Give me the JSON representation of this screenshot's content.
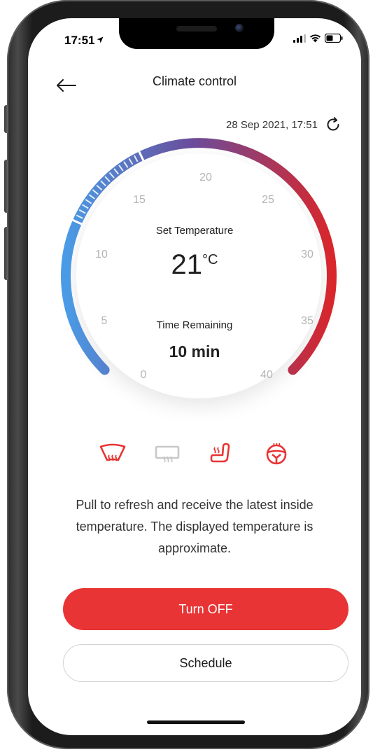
{
  "status_bar": {
    "time": "17:51"
  },
  "header": {
    "title": "Climate control"
  },
  "refresh": {
    "timestamp": "28 Sep 2021, 17:51"
  },
  "dial": {
    "tick_labels": [
      "0",
      "5",
      "10",
      "15",
      "20",
      "25",
      "30",
      "35",
      "40"
    ],
    "set_temperature_label": "Set Temperature",
    "temperature_value": "21",
    "temperature_unit": "°C",
    "time_remaining_label": "Time Remaining",
    "time_remaining_value": "10 min",
    "gradient_start_color": "#4a9be6",
    "gradient_mid_color": "#6b4c9a",
    "gradient_end_color": "#d8262c"
  },
  "features": [
    {
      "name": "front-defrost-icon",
      "active": true
    },
    {
      "name": "rear-defrost-icon",
      "active": false
    },
    {
      "name": "heated-seat-icon",
      "active": true
    },
    {
      "name": "heated-steering-wheel-icon",
      "active": true
    }
  ],
  "info": {
    "text": "Pull to refresh and receive the latest inside temperature. The displayed temperature is approximate."
  },
  "buttons": {
    "turn_off": "Turn OFF",
    "schedule": "Schedule"
  },
  "colors": {
    "accent": "#e83434",
    "inactive_icon": "#c8c8c8"
  }
}
